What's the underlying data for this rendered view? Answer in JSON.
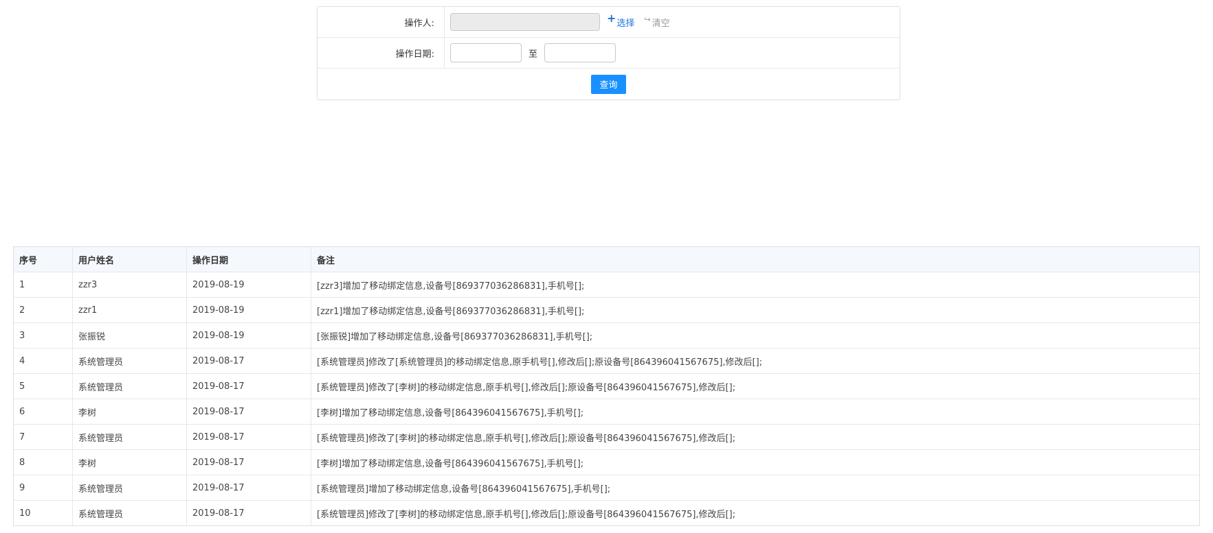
{
  "search": {
    "operator_label": "操作人:",
    "operator_value": "",
    "select_label": "选择",
    "clear_label": "清空",
    "date_label": "操作日期:",
    "date_from": "",
    "date_to_separator": "至",
    "date_to": "",
    "query_button": "查询"
  },
  "table": {
    "headers": [
      "序号",
      "用户姓名",
      "操作日期",
      "备注"
    ],
    "rows": [
      [
        "1",
        "zzr3",
        "2019-08-19",
        "[zzr3]增加了移动绑定信息,设备号[869377036286831],手机号[];"
      ],
      [
        "2",
        "zzr1",
        "2019-08-19",
        "[zzr1]增加了移动绑定信息,设备号[869377036286831],手机号[];"
      ],
      [
        "3",
        "张振锐",
        "2019-08-19",
        "[张振锐]增加了移动绑定信息,设备号[869377036286831],手机号[];"
      ],
      [
        "4",
        "系统管理员",
        "2019-08-17",
        "[系统管理员]修改了[系统管理员]的移动绑定信息,原手机号[],修改后[];原设备号[864396041567675],修改后[];"
      ],
      [
        "5",
        "系统管理员",
        "2019-08-17",
        "[系统管理员]修改了[李树]的移动绑定信息,原手机号[],修改后[];原设备号[864396041567675],修改后[];"
      ],
      [
        "6",
        "李树",
        "2019-08-17",
        "[李树]增加了移动绑定信息,设备号[864396041567675],手机号[];"
      ],
      [
        "7",
        "系统管理员",
        "2019-08-17",
        "[系统管理员]修改了[李树]的移动绑定信息,原手机号[],修改后[];原设备号[864396041567675],修改后[];"
      ],
      [
        "8",
        "李树",
        "2019-08-17",
        "[李树]增加了移动绑定信息,设备号[864396041567675],手机号[];"
      ],
      [
        "9",
        "系统管理员",
        "2019-08-17",
        "[系统管理员]增加了移动绑定信息,设备号[864396041567675],手机号[];"
      ],
      [
        "10",
        "系统管理员",
        "2019-08-17",
        "[系统管理员]修改了[李树]的移动绑定信息,原手机号[],修改后[];原设备号[864396041567675],修改后[];"
      ]
    ]
  },
  "colors": {
    "primary_button": "#1890ff",
    "link_blue": "#1a73d9",
    "header_bg": "#f5f9fd",
    "border": "#dcdfe6"
  },
  "icons": {
    "select": "plus-icon",
    "clear": "clear-icon"
  }
}
